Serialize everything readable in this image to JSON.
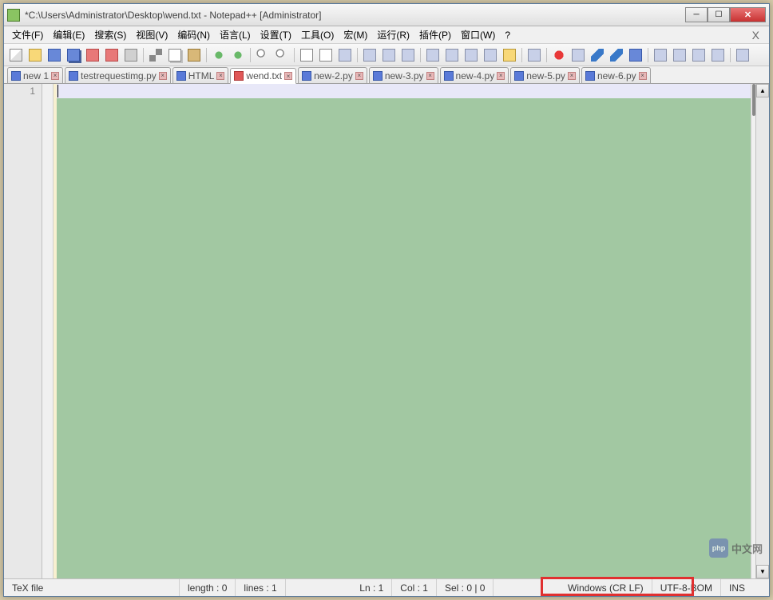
{
  "title": "*C:\\Users\\Administrator\\Desktop\\wend.txt - Notepad++ [Administrator]",
  "menus": [
    "文件(F)",
    "编辑(E)",
    "搜索(S)",
    "视图(V)",
    "编码(N)",
    "语言(L)",
    "设置(T)",
    "工具(O)",
    "宏(M)",
    "运行(R)",
    "插件(P)",
    "窗口(W)",
    "?"
  ],
  "tabs": [
    {
      "label": "new 1",
      "modified": false,
      "active": false
    },
    {
      "label": "testrequestimg.py",
      "modified": false,
      "active": false
    },
    {
      "label": "HTML",
      "modified": false,
      "active": false
    },
    {
      "label": "wend.txt",
      "modified": true,
      "active": true
    },
    {
      "label": "new-2.py",
      "modified": false,
      "active": false
    },
    {
      "label": "new-3.py",
      "modified": false,
      "active": false
    },
    {
      "label": "new-4.py",
      "modified": false,
      "active": false
    },
    {
      "label": "new-5.py",
      "modified": false,
      "active": false
    },
    {
      "label": "new-6.py",
      "modified": false,
      "active": false
    }
  ],
  "gutter": {
    "line1": "1"
  },
  "status": {
    "filetype": "TeX file",
    "length": "length : 0",
    "lines": "lines : 1",
    "ln": "Ln : 1",
    "col": "Col : 1",
    "sel": "Sel : 0 | 0",
    "eol": "Windows (CR LF)",
    "encoding": "UTF-8-BOM",
    "mode": "INS"
  },
  "watermark": {
    "brand": "php",
    "text": "中文网"
  },
  "toolbar_icons": [
    "new-file",
    "open-file",
    "save",
    "save-all",
    "close",
    "close-all",
    "print",
    "sep",
    "cut",
    "copy",
    "paste",
    "sep",
    "undo",
    "redo",
    "sep",
    "find",
    "replace",
    "sep",
    "zoom-in",
    "zoom-out",
    "sync",
    "sep",
    "word-wrap",
    "show-all",
    "indent-guide",
    "sep",
    "lang",
    "doc-map",
    "doc-list",
    "func-list",
    "folder",
    "sep",
    "monitor",
    "sep",
    "record-macro",
    "stop-macro",
    "play-macro",
    "play-multi",
    "save-macro",
    "sep",
    "toggle-1",
    "toggle-2",
    "toggle-3",
    "toggle-4",
    "sep",
    "toggle-5"
  ]
}
